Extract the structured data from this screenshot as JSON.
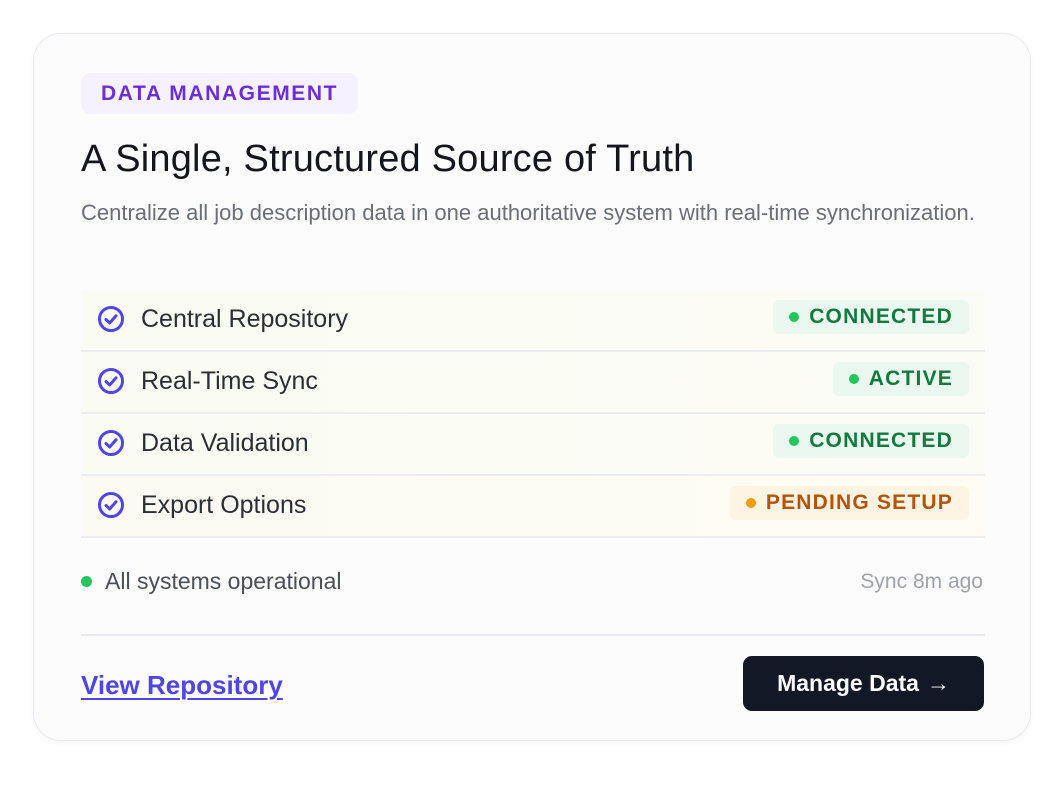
{
  "card": {
    "tag": "DATA MANAGEMENT",
    "title": "A Single, Structured Source of Truth",
    "description": "Centralize all job description data in one authoritative system with real-time synchronization."
  },
  "features": [
    {
      "icon": "check-circle-icon",
      "label": "Central Repository",
      "status": "CONNECTED",
      "state": "ok"
    },
    {
      "icon": "check-circle-icon",
      "label": "Real-Time Sync",
      "status": "ACTIVE",
      "state": "ok"
    },
    {
      "icon": "check-circle-icon",
      "label": "Data Validation",
      "status": "CONNECTED",
      "state": "ok"
    },
    {
      "icon": "check-circle-icon",
      "label": "Export Options",
      "status": "PENDING SETUP",
      "state": "warn"
    }
  ],
  "footer": {
    "status_text": "All systems operational",
    "sync_text": "Sync 8m ago",
    "link_label": "View Repository",
    "button_label": "Manage Data",
    "button_arrow": "→"
  },
  "colors": {
    "accent": "#5145e8",
    "tag_text": "#6d2fd6",
    "ok": "#22c55e",
    "warn": "#f59e0b",
    "button_bg": "#131826"
  }
}
